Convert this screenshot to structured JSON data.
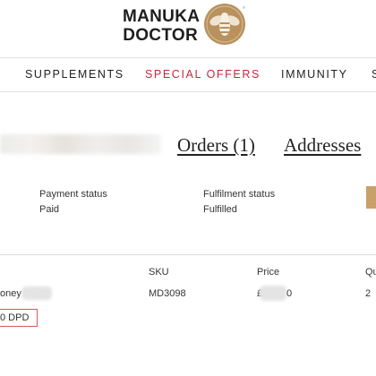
{
  "brand": {
    "line1": "MANUKA",
    "line2": "DOCTOR",
    "emblem_icon": "bee-emblem-icon",
    "accent_color": "#b8915f"
  },
  "nav": {
    "items": [
      {
        "label": "SUPPLEMENTS"
      },
      {
        "label": "SPECIAL OFFERS"
      },
      {
        "label": "IMMUNITY"
      },
      {
        "label": "S"
      }
    ],
    "special_color": "#c8283c"
  },
  "account_tabs": {
    "orders": "Orders (1)",
    "addresses": "Addresses"
  },
  "order_status": {
    "payment_label": "Payment status",
    "payment_value": "Paid",
    "fulfilment_label": "Fulfilment status",
    "fulfilment_value": "Fulfilled"
  },
  "items_table": {
    "headers": {
      "sku": "SKU",
      "price": "Price",
      "quantity": "Qu"
    },
    "row": {
      "product": "oney",
      "sku": "MD3098",
      "price_prefix": "£",
      "price_suffix": "0",
      "quantity": "2"
    },
    "shipping": "0 DPD",
    "highlight_color": "#d65a5a"
  }
}
